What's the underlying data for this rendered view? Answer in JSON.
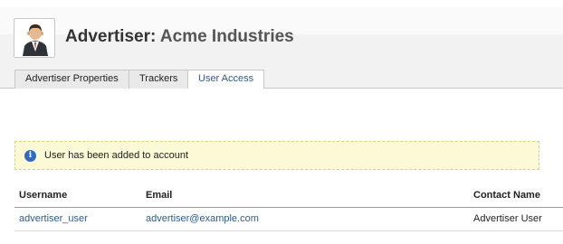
{
  "header": {
    "title_prefix": "Advertiser:",
    "title_name": "Acme Industries",
    "avatar_icon": "person-suit-icon"
  },
  "tabs": [
    {
      "label": "Advertiser Properties",
      "active": false
    },
    {
      "label": "Trackers",
      "active": false
    },
    {
      "label": "User Access",
      "active": true
    }
  ],
  "notice": {
    "icon": "info-icon",
    "glyph": "i",
    "message": "User has been added to account"
  },
  "table": {
    "columns": [
      "Username",
      "Email",
      "Contact Name"
    ],
    "rows": [
      {
        "username": "advertiser_user",
        "email": "advertiser@example.com",
        "contact_name": "Advertiser User"
      }
    ]
  },
  "colors": {
    "link": "#2b5a8f",
    "notice_bg": "#fbf9d6",
    "info_icon": "#2f6bc4"
  }
}
